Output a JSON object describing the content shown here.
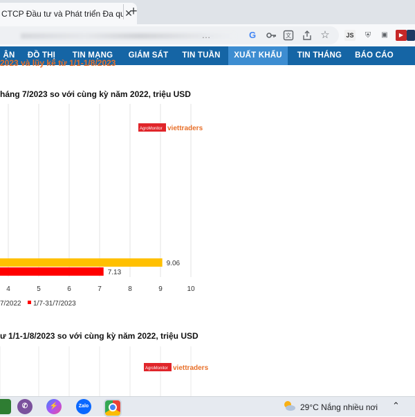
{
  "browser": {
    "tab_title": "CTCP Đầu tư và Phát triển Đa quố",
    "tab_close": "✕",
    "new_tab": "+"
  },
  "site_nav": {
    "items": [
      {
        "label": "ẬN"
      },
      {
        "label": "ĐỒ THỊ"
      },
      {
        "label": "TIN MẠNG"
      },
      {
        "label": "GIÁM SÁT"
      },
      {
        "label": "TIN TUẦN"
      },
      {
        "label": "XUẤT KHẨU",
        "active": true
      },
      {
        "label": "TIN THÁNG"
      },
      {
        "label": "BÁO CÁO"
      }
    ]
  },
  "page": {
    "subtitle_partial": "2023 và lũy kế từ 1/1-1/8/2023",
    "chart1_title": "háng 7/2023 so với cùng kỳ năm 2022, triệu USD",
    "chart2_title": "ư 1/1-1/8/2023 so với cùng kỳ năm 2022, triệu USD",
    "watermark_box": "AgroMonitor",
    "watermark_text": "viettraders"
  },
  "chart_data": [
    {
      "type": "bar",
      "orientation": "horizontal",
      "title": "háng 7/2023 so với cùng kỳ năm 2022, triệu USD",
      "categories": [
        ""
      ],
      "series": [
        {
          "name": "7/2022",
          "values": [
            9.06
          ],
          "color": "#ffc000"
        },
        {
          "name": "1/7-31/7/2023",
          "values": [
            7.13
          ],
          "color": "#ff0000"
        }
      ],
      "data_labels": [
        "9.06",
        "7.13"
      ],
      "x_ticks": [
        4,
        5,
        6,
        7,
        8,
        9,
        10
      ],
      "xlim": [
        0,
        10
      ],
      "grid": true,
      "legend": "bottom"
    }
  ],
  "taskbar": {
    "weather": "29°C  Nắng nhiều nơi",
    "apps": [
      "phone-app",
      "viber",
      "messenger",
      "zalo",
      "chrome"
    ],
    "zalo_label": "Zalo"
  },
  "colors": {
    "nav_bg": "#1565a5",
    "nav_active": "#3d8dd1",
    "subtitle": "#e8702a",
    "bar_2022": "#ffc000",
    "bar_2023": "#ff0000"
  }
}
